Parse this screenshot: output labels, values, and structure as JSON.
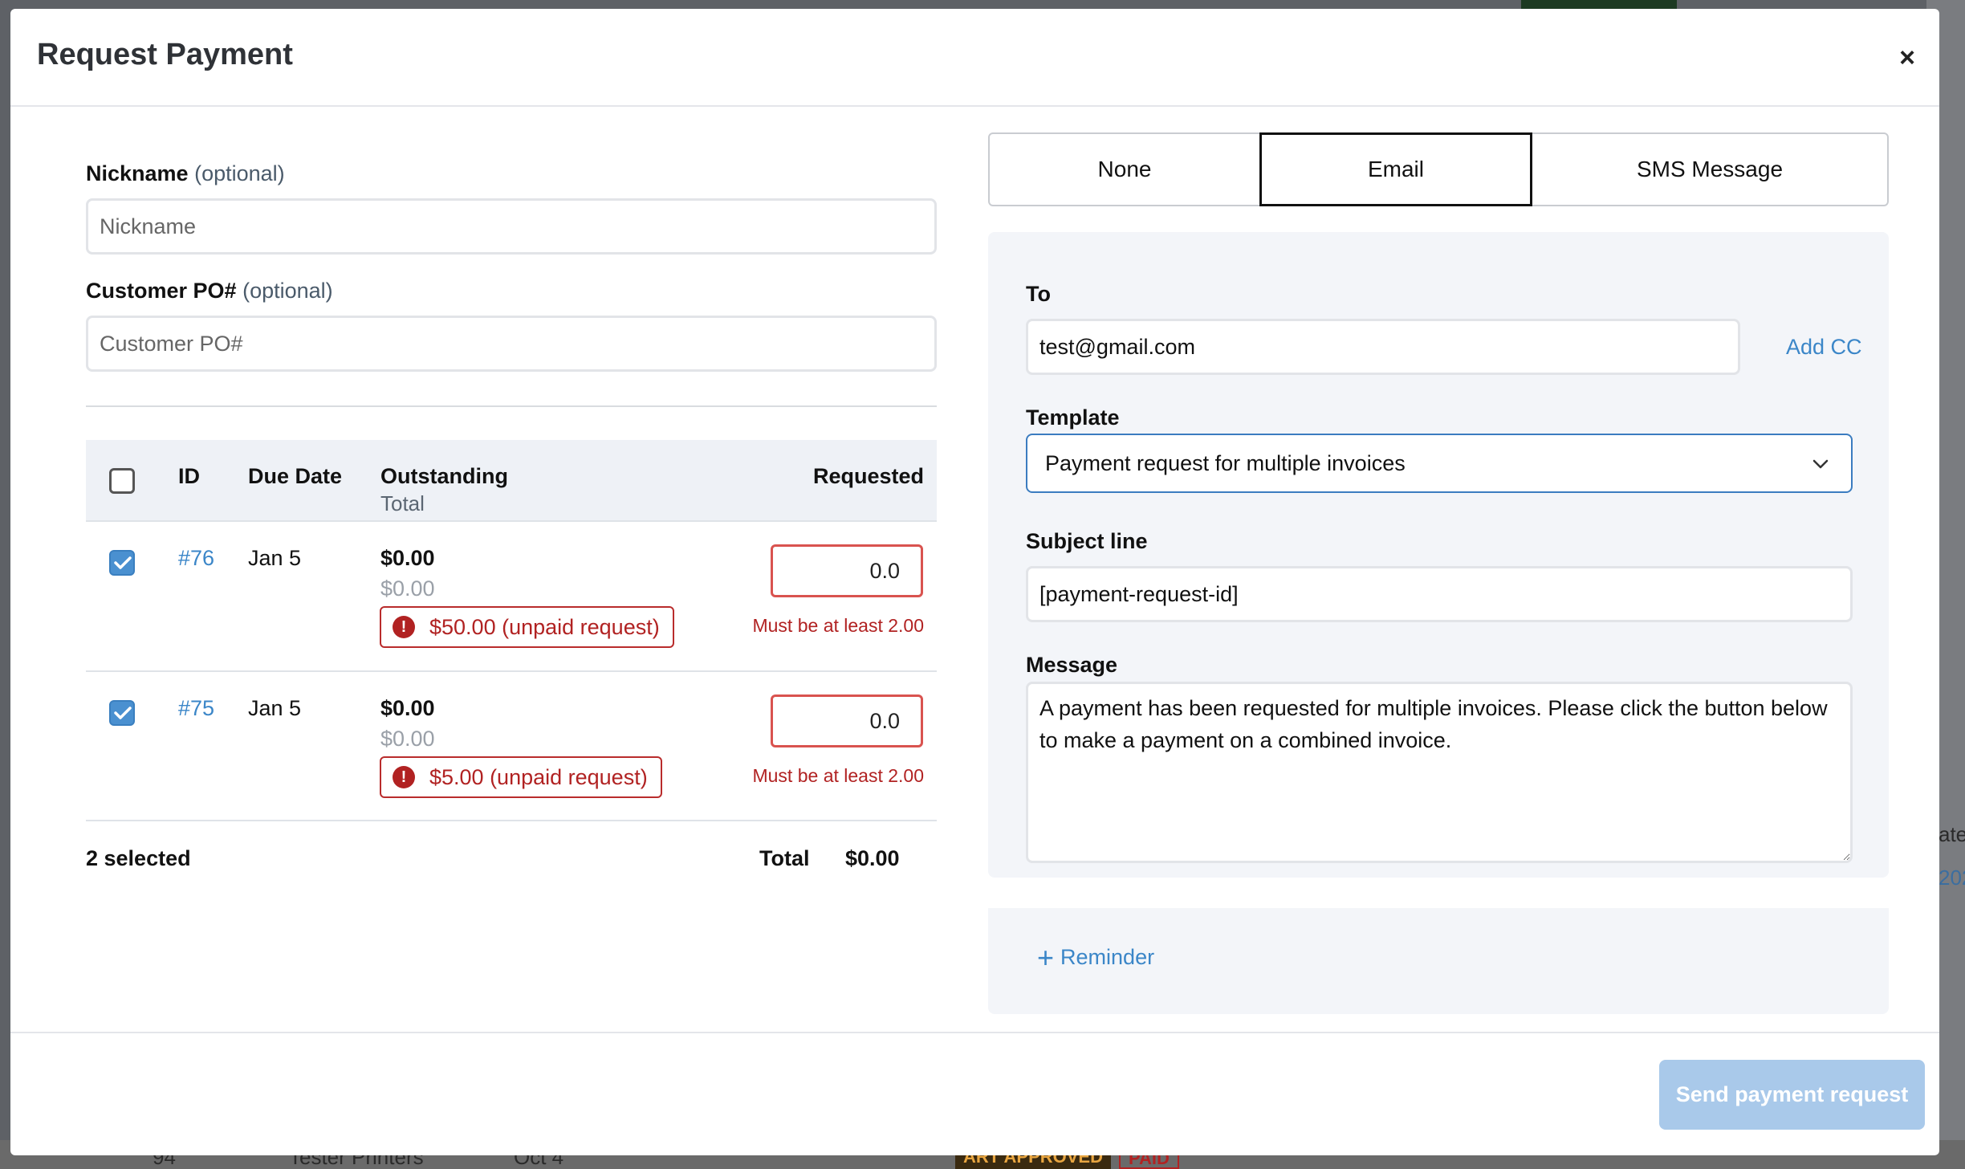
{
  "modal": {
    "title": "Request Payment",
    "close_icon": "×"
  },
  "form": {
    "nickname_label": "Nickname",
    "nickname_optional": "(optional)",
    "nickname_placeholder": "Nickname",
    "po_label": "Customer PO#",
    "po_optional": "(optional)",
    "po_placeholder": "Customer PO#"
  },
  "table": {
    "headers": {
      "id": "ID",
      "due_date": "Due Date",
      "outstanding": "Outstanding",
      "outstanding_sub": "Total",
      "requested": "Requested"
    },
    "rows": [
      {
        "id": "#76",
        "due_date": "Jan 5",
        "outstanding": "$0.00",
        "total": "$0.00",
        "unpaid": "$50.00 (unpaid request)",
        "requested": "0.0",
        "error": "Must be at least 2.00",
        "checked": true
      },
      {
        "id": "#75",
        "due_date": "Jan 5",
        "outstanding": "$0.00",
        "total": "$0.00",
        "unpaid": "$5.00 (unpaid request)",
        "requested": "0.0",
        "error": "Must be at least 2.00",
        "checked": true
      }
    ],
    "footer": {
      "selected": "2 selected",
      "total_label": "Total",
      "total_value": "$0.00"
    }
  },
  "delivery": {
    "tabs": [
      "None",
      "Email",
      "SMS Message"
    ],
    "active_tab": "Email",
    "to_label": "To",
    "to_value": "test@gmail.com",
    "add_cc": "Add CC",
    "template_label": "Template",
    "template_value": "Payment request for multiple invoices",
    "subject_label": "Subject line",
    "subject_value": "[payment-request-id]",
    "message_label": "Message",
    "message_value": "A payment has been requested for multiple invoices. Please click the button below to make a payment on a combined invoice.",
    "reminder": "Reminder"
  },
  "actions": {
    "send": "Send payment request"
  },
  "background": {
    "right_fragments": [
      "ate",
      "202"
    ],
    "bottom_fragments": [
      "94",
      "Tester Printers",
      "Oct 4"
    ],
    "badges": [
      "ART APPROVED",
      "PAID"
    ]
  },
  "colors": {
    "accent": "#3b86c8",
    "error": "#b12222",
    "send_disabled": "#a9c9ea"
  }
}
